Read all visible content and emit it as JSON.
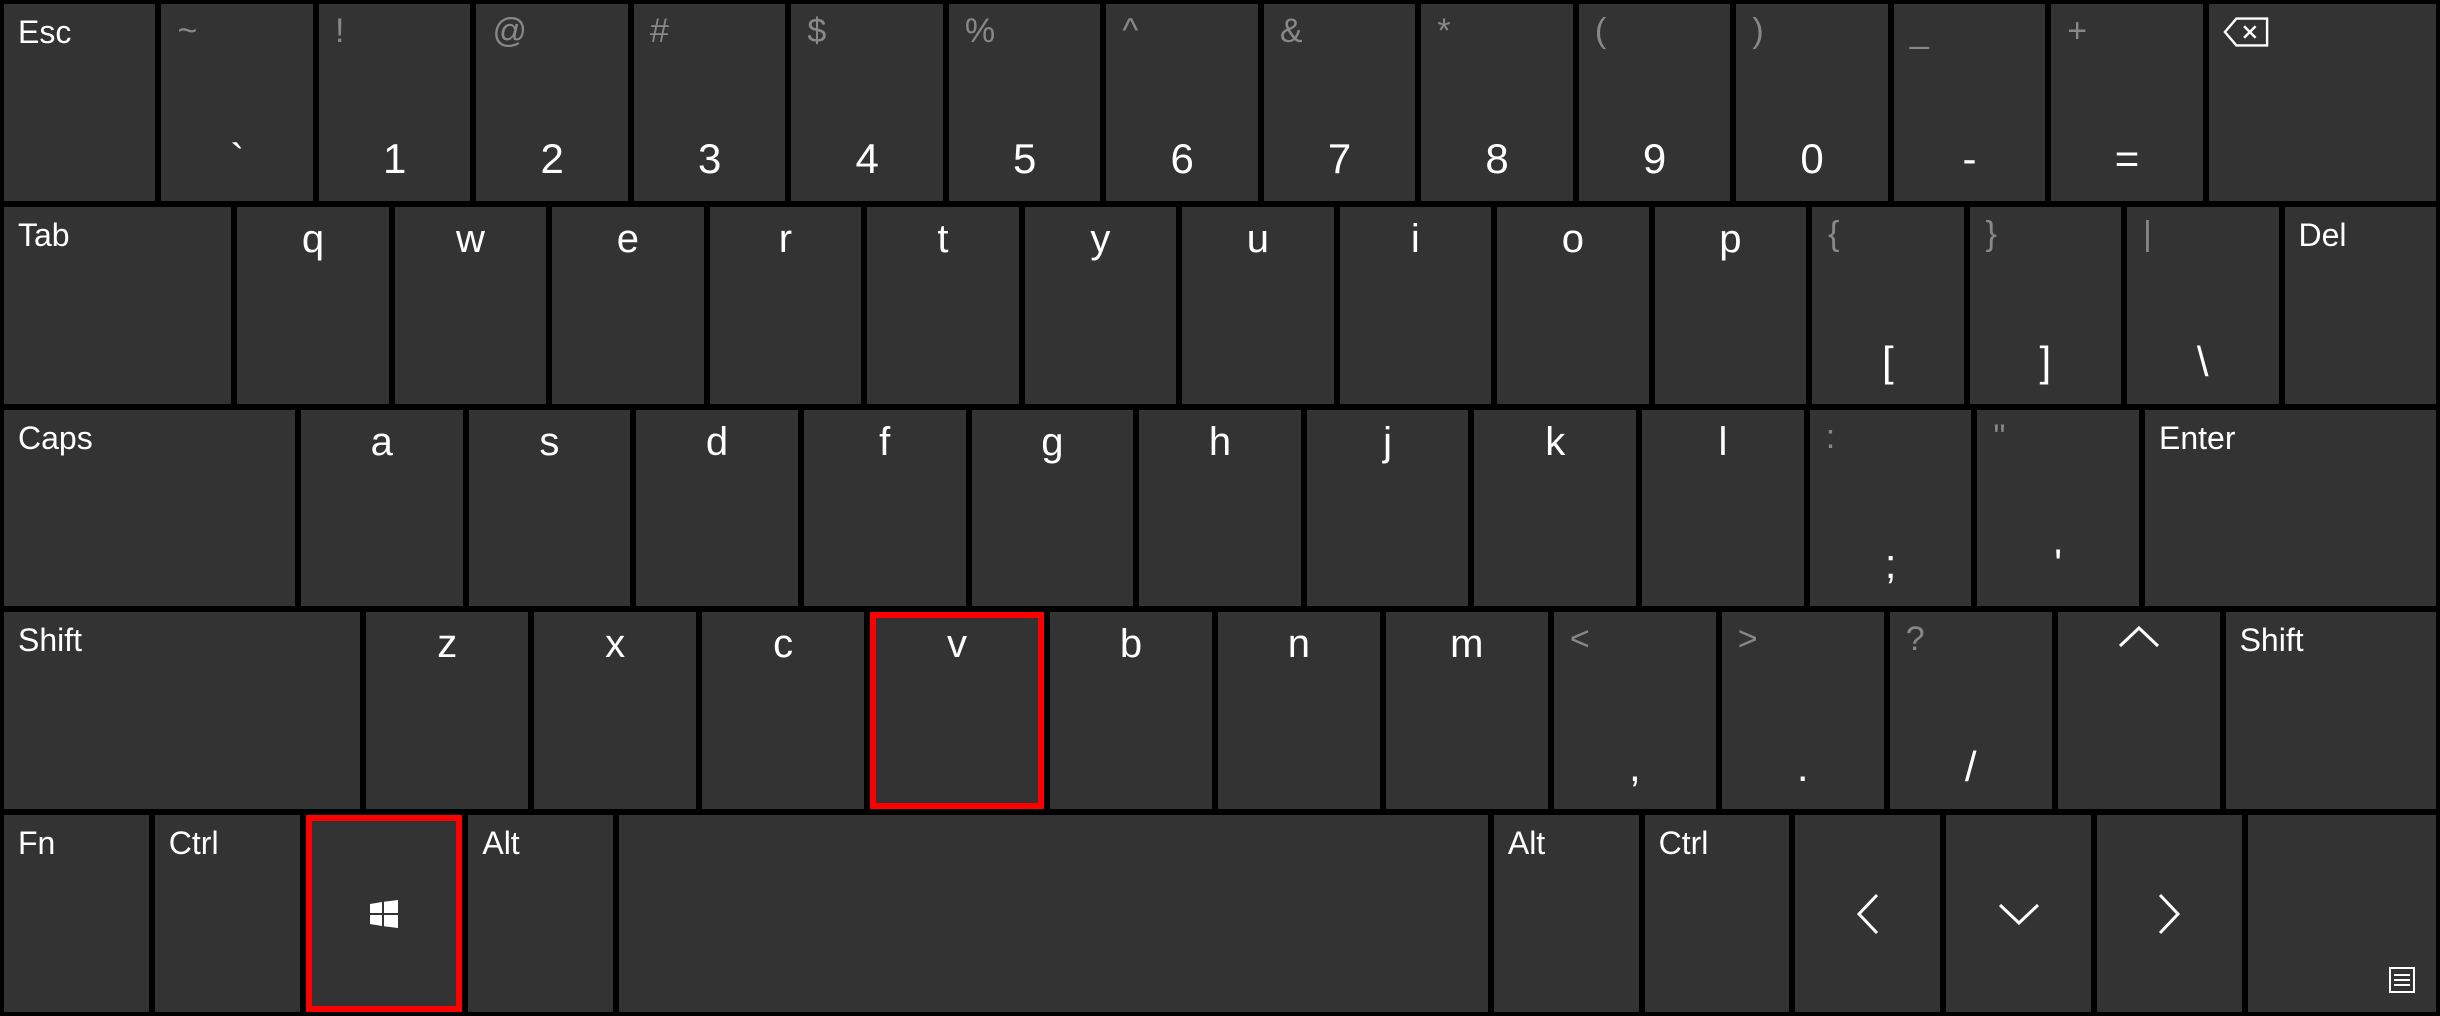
{
  "row1": {
    "esc": "Esc",
    "keys": [
      {
        "upper": "~",
        "lower": "`"
      },
      {
        "upper": "!",
        "lower": "1"
      },
      {
        "upper": "@",
        "lower": "2"
      },
      {
        "upper": "#",
        "lower": "3"
      },
      {
        "upper": "$",
        "lower": "4"
      },
      {
        "upper": "%",
        "lower": "5"
      },
      {
        "upper": "^",
        "lower": "6"
      },
      {
        "upper": "&",
        "lower": "7"
      },
      {
        "upper": "*",
        "lower": "8"
      },
      {
        "upper": "(",
        "lower": "9"
      },
      {
        "upper": ")",
        "lower": "0"
      },
      {
        "upper": "_",
        "lower": "-"
      },
      {
        "upper": "+",
        "lower": "="
      }
    ],
    "backspace_icon": "backspace"
  },
  "row2": {
    "tab": "Tab",
    "letters": [
      "q",
      "w",
      "e",
      "r",
      "t",
      "y",
      "u",
      "i",
      "o",
      "p"
    ],
    "brackets": [
      {
        "upper": "{",
        "lower": "["
      },
      {
        "upper": "}",
        "lower": "]"
      },
      {
        "upper": "|",
        "lower": "\\"
      }
    ],
    "del": "Del"
  },
  "row3": {
    "caps": "Caps",
    "letters": [
      "a",
      "s",
      "d",
      "f",
      "g",
      "h",
      "j",
      "k",
      "l"
    ],
    "punct": [
      {
        "upper": ":",
        "lower": ";"
      },
      {
        "upper": "\"",
        "lower": "'"
      }
    ],
    "enter": "Enter"
  },
  "row4": {
    "shift_l": "Shift",
    "letters": [
      "z",
      "x",
      "c",
      "v",
      "b",
      "n",
      "m"
    ],
    "punct": [
      {
        "upper": "<",
        "lower": ","
      },
      {
        "upper": ">",
        "lower": "."
      },
      {
        "upper": "?",
        "lower": "/"
      }
    ],
    "up_arrow": "up",
    "shift_r": "Shift"
  },
  "row5": {
    "fn": "Fn",
    "ctrl_l": "Ctrl",
    "win": "win",
    "alt_l": "Alt",
    "alt_r": "Alt",
    "ctrl_r": "Ctrl",
    "arrows": [
      "left",
      "down",
      "right"
    ],
    "menu": "menu"
  },
  "highlighted_keys": [
    "v-key",
    "win-key"
  ]
}
